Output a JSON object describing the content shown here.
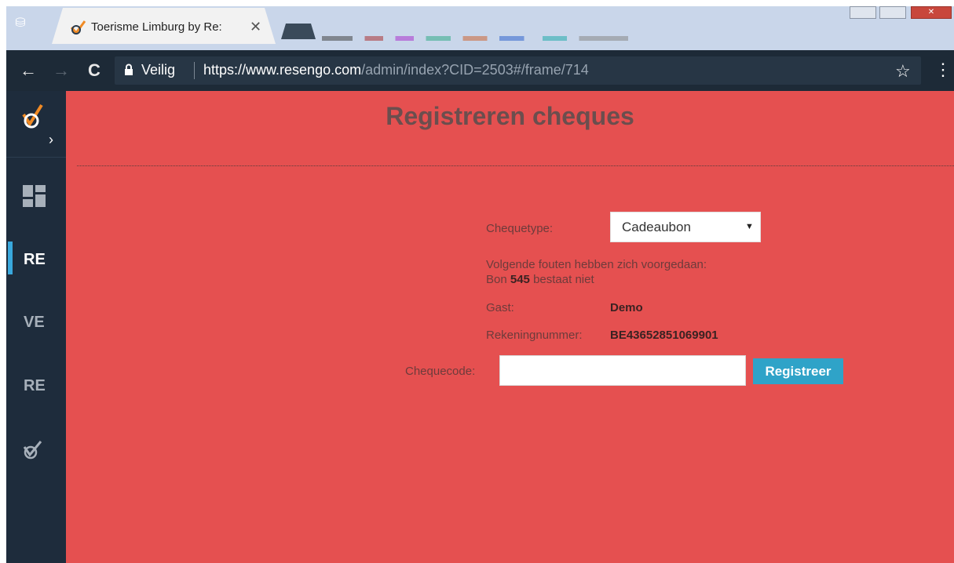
{
  "browser": {
    "tab_title": "Toerisme Limburg by Re:",
    "tab_close": "✕",
    "security_label": "Veilig",
    "url_scheme": "https://",
    "url_host": "www.resengo.com",
    "url_path": "/admin/index?CID=2503#/frame/714",
    "back_icon": "←",
    "forward_icon": "→",
    "reload_icon": "C",
    "star_icon": "☆",
    "menu_icon": "⋮",
    "incognito_icon": "⛁"
  },
  "sidebar": {
    "chevron": "›",
    "items": [
      {
        "label": "RE",
        "active": true
      },
      {
        "label": "VE",
        "active": false
      },
      {
        "label": "RE",
        "active": false
      }
    ],
    "accent_color": "#39a8dd"
  },
  "page": {
    "title": "Registreren cheques",
    "background_color": "#e55050"
  },
  "form": {
    "chequetype_label": "Chequetype:",
    "chequetype_value": "Cadeaubon",
    "error_intro": "Volgende fouten hebben zich voorgedaan:",
    "error_prefix": "Bon",
    "error_number": "545",
    "error_suffix": "bestaat niet",
    "guest_label": "Gast:",
    "guest_value": "Demo",
    "account_label": "Rekeningnummer:",
    "account_value": "BE43652851069901",
    "code_label": "Chequecode:",
    "code_value": "",
    "register_button": "Registreer"
  }
}
